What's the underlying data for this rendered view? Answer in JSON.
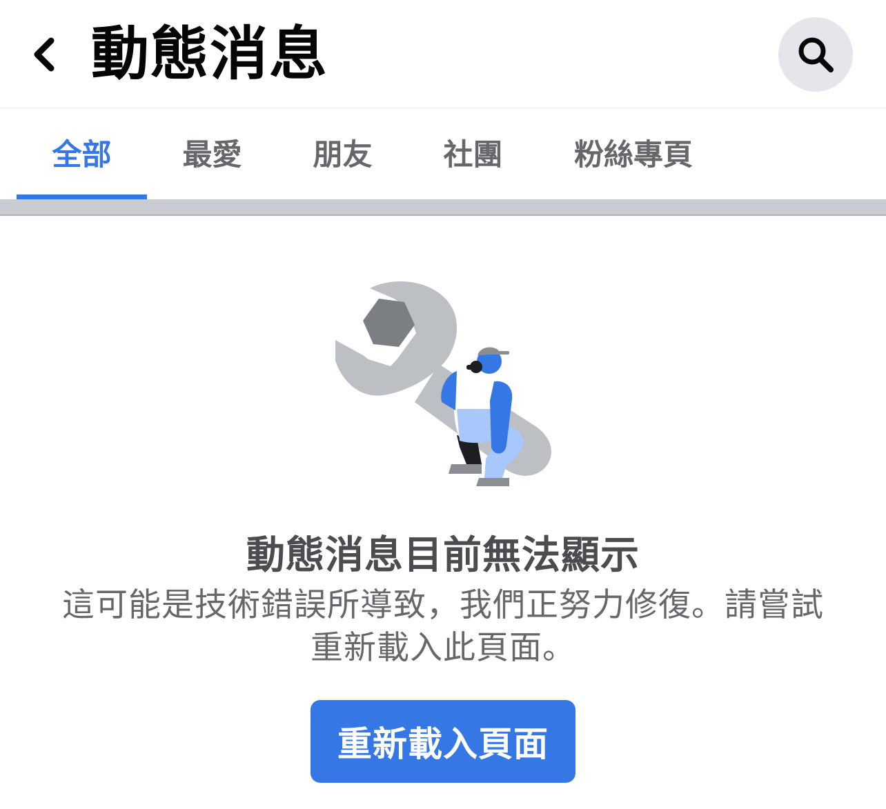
{
  "header": {
    "back_icon": "chevron-left-icon",
    "title": "動態消息",
    "search_icon": "search-icon"
  },
  "tabs": [
    {
      "label": "全部",
      "active": true
    },
    {
      "label": "最愛",
      "active": false
    },
    {
      "label": "朋友",
      "active": false
    },
    {
      "label": "社團",
      "active": false
    },
    {
      "label": "粉絲專頁",
      "active": false
    }
  ],
  "error": {
    "illustration": "wrench-worker-illustration",
    "title": "動態消息目前無法顯示",
    "message": "這可能是技術錯誤所導致，我們正努力修復。請嘗試重新載入此頁面。",
    "button_label": "重新載入頁面"
  },
  "colors": {
    "accent": "#3578e5",
    "title_text": "#050505",
    "secondary_text": "#65676b",
    "divider": "#c9ccd1",
    "search_bg": "#e4e6eb"
  }
}
